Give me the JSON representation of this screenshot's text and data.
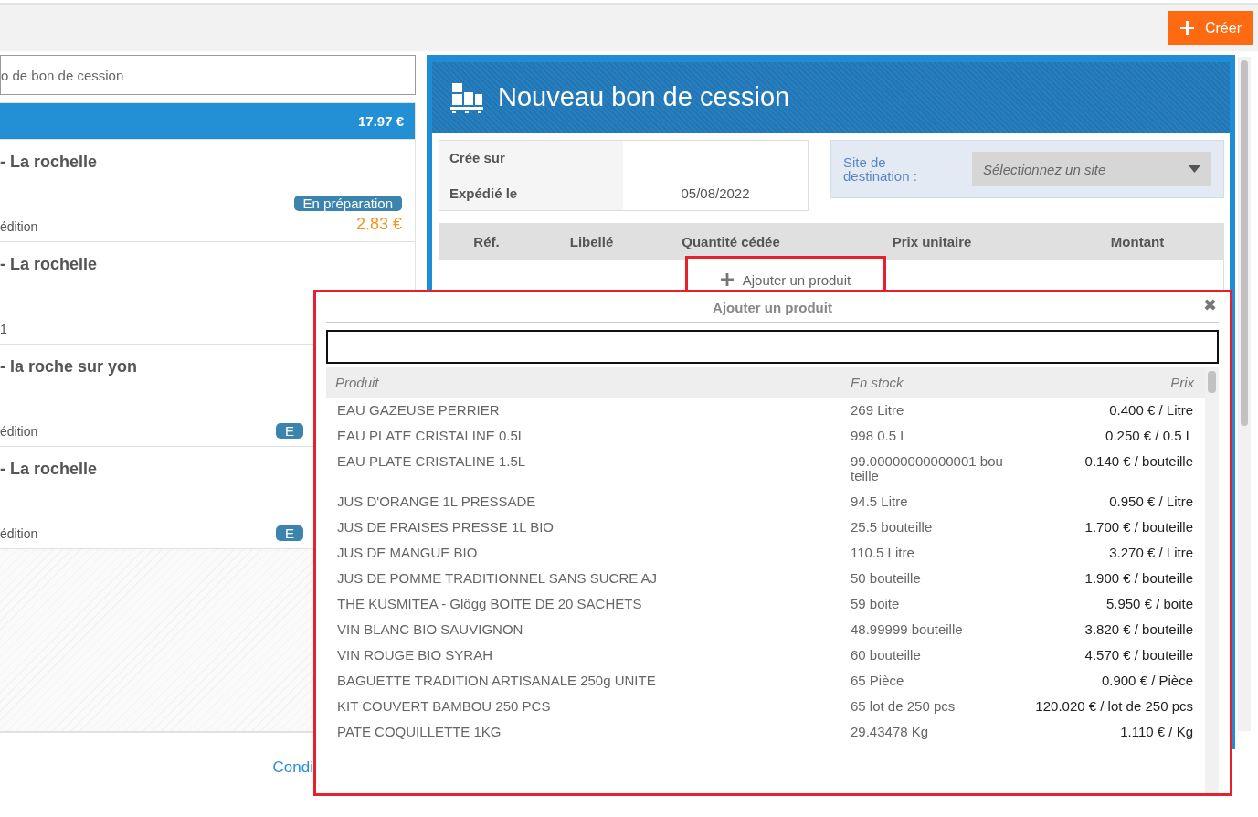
{
  "top_bar": {
    "create_button": "Créer"
  },
  "left_panel": {
    "search": {
      "placeholder": "o de bon de cession"
    },
    "items": [
      {
        "selected": true,
        "amount": "17.97 €"
      },
      {
        "selected": false,
        "title": "- La rochelle",
        "badge": "En préparation",
        "amount": "2.83 €",
        "note": "édition"
      },
      {
        "selected": false,
        "title": "- La rochelle",
        "note": "1"
      },
      {
        "selected": false,
        "title": "- la roche sur yon",
        "badge": "E",
        "note": "édition"
      },
      {
        "selected": false,
        "title": "- La rochelle",
        "badge": "E",
        "note": "édition"
      }
    ],
    "footer_link": "Condi"
  },
  "form": {
    "title": "Nouveau bon de cession",
    "fields": [
      {
        "label": "Crée sur"
      },
      {
        "label": "Expédié le",
        "value": "05/08/2022"
      }
    ],
    "destination": {
      "label": "Site de destination :",
      "placeholder": "Sélectionnez un site"
    },
    "columns": [
      "Réf.",
      "Libellé",
      "Quantité cédée",
      "Prix unitaire",
      "Montant"
    ],
    "add_product": "Ajouter un produit"
  },
  "dialog": {
    "title": "Ajouter un produit",
    "close": "✖",
    "columns": [
      "Produit",
      "En stock",
      "Prix"
    ],
    "rows": [
      [
        "EAU GAZEUSE PERRIER",
        "269 Litre",
        "0.400 € / Litre"
      ],
      [
        "EAU PLATE CRISTALINE 0.5L",
        "998 0.5 L",
        "0.250 € / 0.5 L"
      ],
      [
        "EAU PLATE CRISTALINE 1.5L",
        "99.00000000000001 bouteille",
        "0.140 € / bouteille"
      ],
      [
        "JUS D'ORANGE 1L PRESSADE",
        "94.5 Litre",
        "0.950 € / Litre"
      ],
      [
        "JUS DE FRAISES PRESSE 1L BIO",
        "25.5 bouteille",
        "1.700 € / bouteille"
      ],
      [
        "JUS DE MANGUE BIO",
        "110.5 Litre",
        "3.270 € / Litre"
      ],
      [
        "JUS DE POMME TRADITIONNEL SANS SUCRE AJ",
        "50 bouteille",
        "1.900 € / bouteille"
      ],
      [
        "THE KUSMITEA - Glögg BOITE DE 20 SACHETS",
        "59 boite",
        "5.950 € / boite"
      ],
      [
        "VIN BLANC BIO SAUVIGNON",
        "48.99999 bouteille",
        "3.820 € / bouteille"
      ],
      [
        "VIN ROUGE BIO SYRAH",
        "60 bouteille",
        "4.570 € / bouteille"
      ],
      [
        "BAGUETTE TRADITION ARTISANALE 250g UNITE",
        "65 Pièce",
        "0.900 € / Pièce"
      ],
      [
        "KIT COUVERT BAMBOU 250 PCS",
        "65 lot de 250 pcs",
        "120.020 € / lot de 250 pcs"
      ],
      [
        "PATE COQUILLETTE 1KG",
        "29.43478 Kg",
        "1.110 € / Kg"
      ]
    ]
  }
}
